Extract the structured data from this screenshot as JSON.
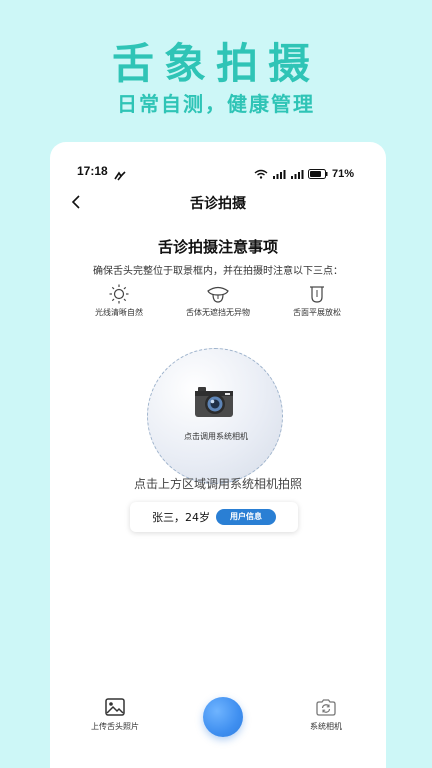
{
  "hero": {
    "title": "舌象拍摄",
    "subtitle": "日常自测，健康管理"
  },
  "status_bar": {
    "time": "17:18",
    "battery": "71%"
  },
  "nav": {
    "title": "舌诊拍摄"
  },
  "notice": {
    "title": "舌诊拍摄注意事项",
    "description": "确保舌头完整位于取景框内，并在拍摄时注意以下三点：",
    "tips": [
      {
        "icon": "sun-icon",
        "label": "光线清晰自然"
      },
      {
        "icon": "tongue-out-icon",
        "label": "舌体无遮挡无异物"
      },
      {
        "icon": "tongue-flat-icon",
        "label": "舌面平展放松"
      }
    ]
  },
  "camera": {
    "circle_label": "点击调用系统相机",
    "hint": "点击上方区域调用系统相机拍照"
  },
  "user": {
    "name_age": "张三，24岁",
    "info_button": "用户信息"
  },
  "bottom_bar": {
    "upload_label": "上传舌头照片",
    "system_camera_label": "系统相机"
  },
  "colors": {
    "background": "#cdf7f7",
    "brand_teal": "#2fc4b6",
    "accent_blue": "#2a7fd4"
  }
}
